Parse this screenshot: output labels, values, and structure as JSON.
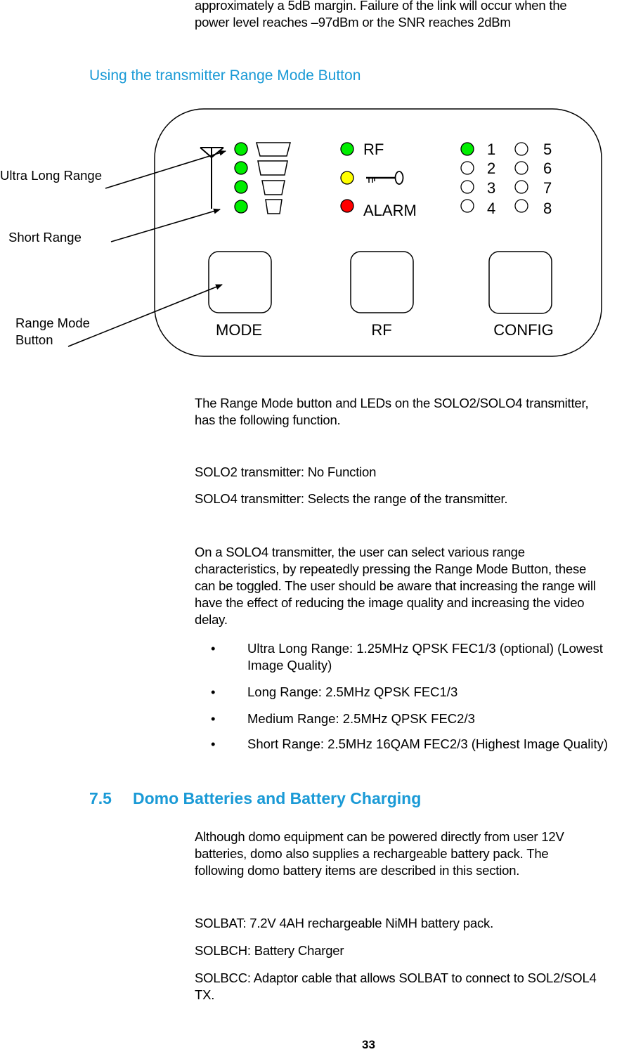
{
  "intro": {
    "line1": "approximately a 5dB margin.  Failure of the link will occur when the",
    "line2": "power level reaches –97dBm or the SNR reaches 2dBm"
  },
  "subheading": "Using the transmitter Range Mode Button",
  "diagram": {
    "callouts": {
      "ultra_long_range": "Ultra Long Range",
      "short_range": "Short Range",
      "range_mode_button_line1": "Range Mode",
      "range_mode_button_line2": "Button"
    },
    "range_leds": [
      {
        "level": "ultra-long",
        "color": "#00ee00"
      },
      {
        "level": "long",
        "color": "#00ee00"
      },
      {
        "level": "medium",
        "color": "#00ee00"
      },
      {
        "level": "short",
        "color": "#00ee00"
      }
    ],
    "status_leds": [
      {
        "label": "RF",
        "color": "#00ee00"
      },
      {
        "label": "",
        "icon": "key-icon",
        "color": "#ffff00"
      },
      {
        "label": "ALARM",
        "color": "#ff0000"
      }
    ],
    "channel_leds": [
      {
        "label": "1",
        "on": true,
        "color": "#00ee00"
      },
      {
        "label": "2",
        "on": false
      },
      {
        "label": "3",
        "on": false
      },
      {
        "label": "4",
        "on": false
      },
      {
        "label": "5",
        "on": false
      },
      {
        "label": "6",
        "on": false
      },
      {
        "label": "7",
        "on": false
      },
      {
        "label": "8",
        "on": false
      }
    ],
    "buttons": {
      "mode": "MODE",
      "rf": "RF",
      "config": "CONFIG"
    }
  },
  "para1": {
    "line1": "The Range Mode button and LEDs on the SOLO2/SOLO4 transmitter,",
    "line2": "has the following function."
  },
  "solo2": "SOLO2 transmitter: No Function",
  "solo4": "SOLO4 transmitter: Selects the range of the transmitter.",
  "para2": {
    "lines": [
      "On a SOLO4 transmitter, the user can select various range",
      "characteristics, by repeatedly pressing the Range Mode Button, these",
      "can be toggled.  The user should be aware that increasing the range will",
      "have the effect of reducing the image quality and increasing the video",
      "delay."
    ]
  },
  "bullets": {
    "symbol": "•",
    "items": [
      {
        "line1": "Ultra Long Range: 1.25MHz QPSK FEC1/3 (optional) (Lowest",
        "line2": "Image Quality)"
      },
      {
        "line1": "Long Range: 2.5MHz QPSK FEC1/3"
      },
      {
        "line1": "Medium Range: 2.5MHz QPSK FEC2/3"
      },
      {
        "line1": "Short Range: 2.5MHz 16QAM FEC2/3 (Highest Image Quality)"
      }
    ]
  },
  "section": {
    "number": "7.5",
    "title": "Domo Batteries and Battery Charging"
  },
  "para3": {
    "lines": [
      "Although domo equipment can be powered directly from user 12V",
      "batteries, domo also supplies a rechargeable battery pack.  The",
      "following domo battery items are described in this section."
    ]
  },
  "items": {
    "solbat": "SOLBAT:  7.2V 4AH rechargeable NiMH battery pack.",
    "solbch": "SOLBCH: Battery Charger",
    "solbcc_line1": "SOLBCC: Adaptor cable that allows SOLBAT to connect to SOL2/SOL4",
    "solbcc_line2": "TX."
  },
  "page_number": "33",
  "colors": {
    "heading_blue": "#1a9ad6",
    "led_green": "#00ee00",
    "led_yellow": "#ffff00",
    "led_red": "#ff0000"
  }
}
